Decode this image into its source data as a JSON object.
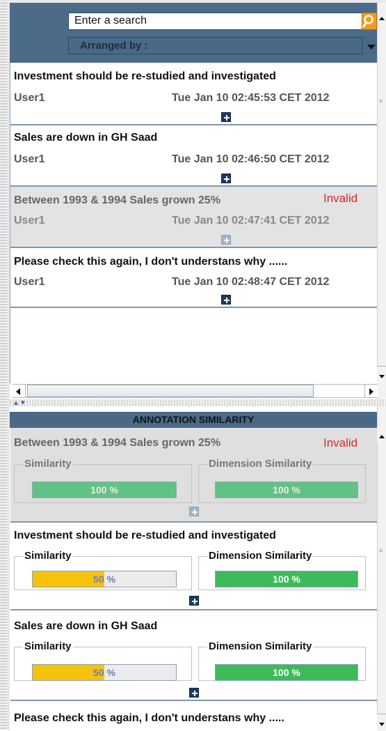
{
  "search": {
    "placeholder": "Enter a search",
    "icon": "search-icon"
  },
  "arranged": {
    "label": "Arranged by :"
  },
  "annotations": [
    {
      "title": "Investment should be re-studied and investigated",
      "user": "User1",
      "date": "Tue Jan 10 02:45:53 CET 2012",
      "status": ""
    },
    {
      "title": "Sales are down in GH Saad",
      "user": "User1",
      "date": "Tue Jan 10 02:46:50 CET 2012",
      "status": ""
    },
    {
      "title": "Between 1993 & 1994 Sales grown 25%",
      "user": "User1",
      "date": "Tue Jan 10 02:47:41 CET 2012",
      "status": "Invalid"
    },
    {
      "title": "Please check this again, I don't understans why ......",
      "user": "User1",
      "date": "Tue Jan 10 02:48:47 CET 2012",
      "status": ""
    }
  ],
  "similarity_panel": {
    "title": "ANNOTATION SIMILARITY",
    "similarity_label": "Similarity",
    "dimension_label": "Dimension Similarity",
    "items": [
      {
        "title": "Between 1993 & 1994 Sales grown 25%",
        "status": "Invalid",
        "similarity": "100 %",
        "similarity_percent": 100,
        "dimension": "100 %",
        "dimension_percent": 100
      },
      {
        "title": "Investment should be re-studied and investigated",
        "status": "",
        "similarity": "50 %",
        "similarity_percent": 50,
        "dimension": "100 %",
        "dimension_percent": 100
      },
      {
        "title": "Sales are down in GH Saad",
        "status": "",
        "similarity": "50 %",
        "similarity_percent": 50,
        "dimension": "100 %",
        "dimension_percent": 100
      },
      {
        "title": "Please check this again, I don't understans why .....",
        "status": "",
        "similarity": "",
        "dimension": ""
      }
    ]
  },
  "colors": {
    "header_bg": "#4b6b88",
    "invalid_text": "#d52b2b",
    "similarity_fill": "#f7c20c",
    "dimension_fill": "#3dbb59",
    "expand_button": "#1d3a63"
  }
}
